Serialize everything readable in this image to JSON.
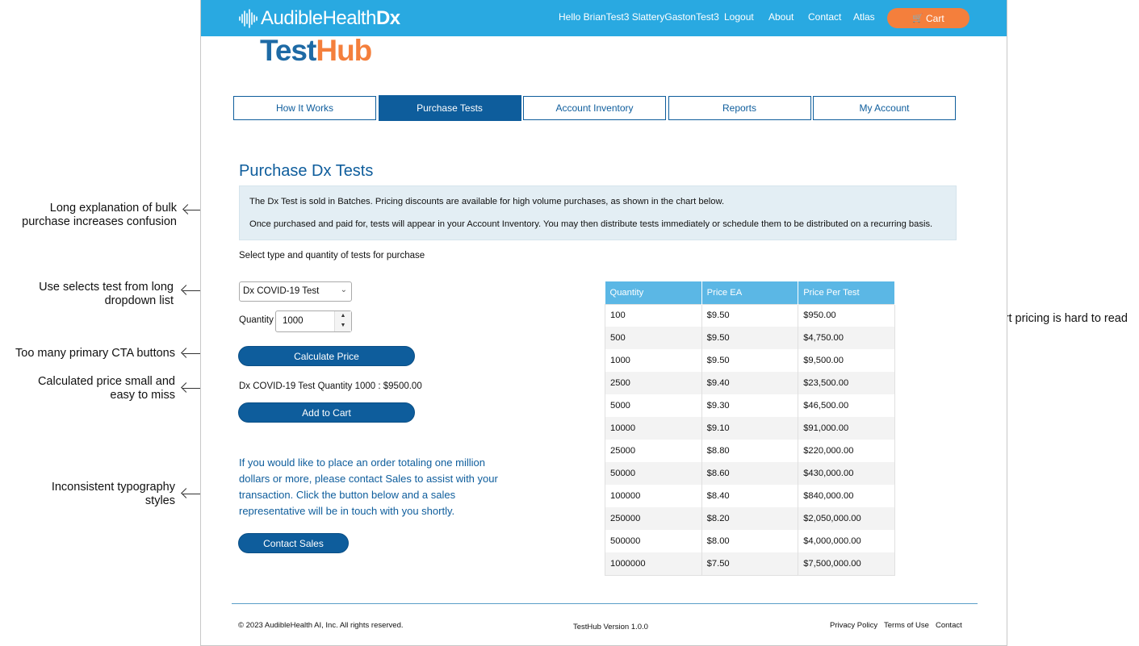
{
  "annotations": {
    "bulk_explanation": [
      "Long explanation of bulk",
      "purchase increases confusion"
    ],
    "dropdown": [
      "Use selects test from long",
      "dropdown list"
    ],
    "cta": [
      "Too many primary CTA buttons"
    ],
    "calc_price": [
      "Calculated price small and",
      "easy to miss"
    ],
    "typography": [
      "Inconsistent typography",
      "styles"
    ],
    "bulk_chart": [
      "Bulk chart pricing is hard to read"
    ]
  },
  "header": {
    "brand_main": "AudibleHealth",
    "brand_dx": "Dx",
    "greeting": "Hello BrianTest3 SlatteryGastonTest3",
    "logout": "Logout",
    "about": "About",
    "contact": "Contact",
    "atlas": "Atlas",
    "cart": "Cart",
    "accent_color": "#29a9e1",
    "cart_color": "#f47f3c"
  },
  "logo": {
    "part1": "Test",
    "part2": "Hub"
  },
  "tabs": [
    {
      "label": "How It Works",
      "active": false
    },
    {
      "label": "Purchase Tests",
      "active": true
    },
    {
      "label": "Account Inventory",
      "active": false
    },
    {
      "label": "Reports",
      "active": false
    },
    {
      "label": "My Account",
      "active": false
    }
  ],
  "main": {
    "title": "Purchase Dx Tests",
    "info_line1": "The Dx Test is sold in Batches. Pricing discounts are available for high volume purchases, as shown in the chart below.",
    "info_line2": "Once purchased and paid for, tests will appear in your Account Inventory. You may then distribute tests immediately or schedule them to be distributed on a recurring basis.",
    "select_label": "Select type and quantity of tests for purchase",
    "test_type": "Dx COVID-19 Test",
    "quantity_label": "Quantity",
    "quantity_value": "1000",
    "calculate_button": "Calculate Price",
    "calc_result": "Dx COVID-19 Test Quantity 1000 : $9500.00",
    "add_to_cart_button": "Add to Cart",
    "sales_text": "If you would like to place an order totaling one million dollars or more, please contact Sales to assist with your transaction. Click the button below and a sales representative will be in touch with you shortly.",
    "contact_sales_button": "Contact Sales"
  },
  "pricing_table": {
    "headers": [
      "Quantity",
      "Price EA",
      "Price Per Test"
    ],
    "rows": [
      [
        "100",
        "$9.50",
        "$950.00"
      ],
      [
        "500",
        "$9.50",
        "$4,750.00"
      ],
      [
        "1000",
        "$9.50",
        "$9,500.00"
      ],
      [
        "2500",
        "$9.40",
        "$23,500.00"
      ],
      [
        "5000",
        "$9.30",
        "$46,500.00"
      ],
      [
        "10000",
        "$9.10",
        "$91,000.00"
      ],
      [
        "25000",
        "$8.80",
        "$220,000.00"
      ],
      [
        "50000",
        "$8.60",
        "$430,000.00"
      ],
      [
        "100000",
        "$8.40",
        "$840,000.00"
      ],
      [
        "250000",
        "$8.20",
        "$2,050,000.00"
      ],
      [
        "500000",
        "$8.00",
        "$4,000,000.00"
      ],
      [
        "1000000",
        "$7.50",
        "$7,500,000.00"
      ]
    ]
  },
  "footer": {
    "copyright": "© 2023 AudibleHealth AI, Inc. All rights reserved.",
    "version": "TestHub Version 1.0.0",
    "privacy": "Privacy Policy",
    "terms": "Terms of Use",
    "contact": "Contact"
  }
}
